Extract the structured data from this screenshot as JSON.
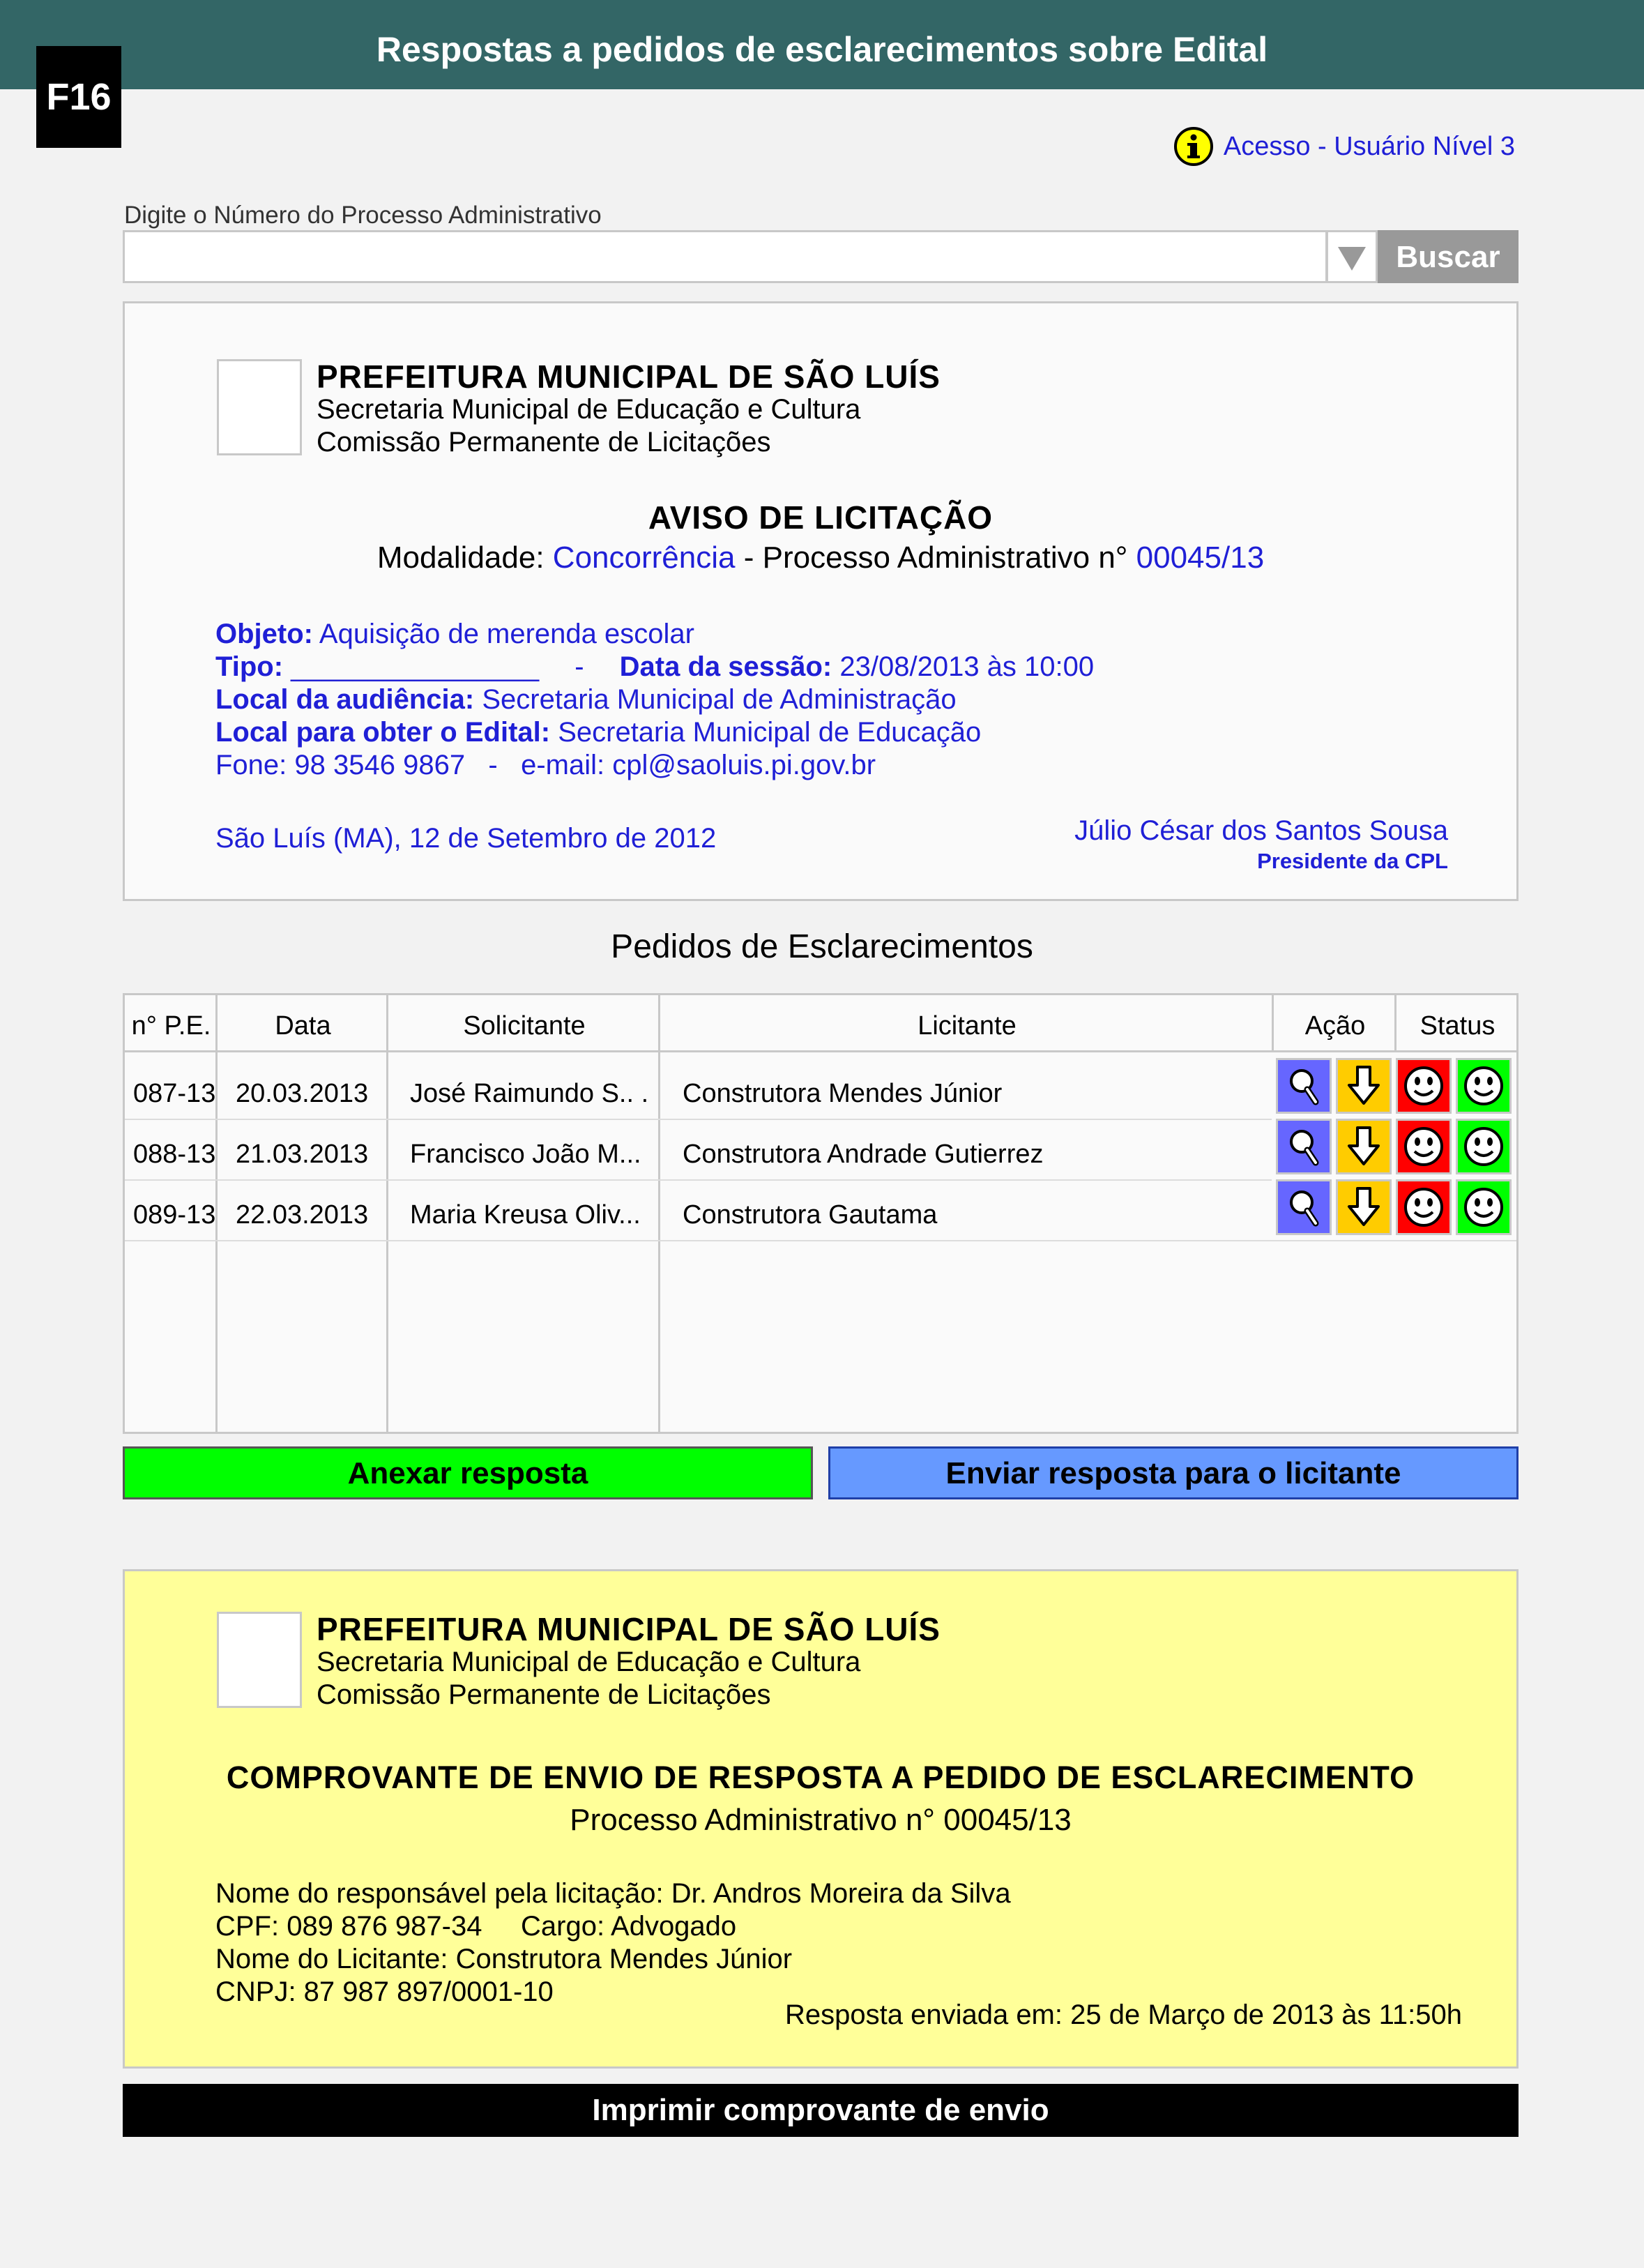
{
  "header": {
    "title": "Respostas a pedidos de esclarecimentos sobre Edital",
    "screen_id": "F16"
  },
  "access": {
    "label": "Acesso - Usuário Nível 3",
    "icon": "info-icon"
  },
  "search": {
    "label": "Digite o Número do Processo Administrativo",
    "value": "",
    "placeholder": "",
    "button": "Buscar"
  },
  "notice": {
    "org": {
      "name": "PREFEITURA MUNICIPAL DE SÃO LUÍS",
      "dept": "Secretaria Municipal de Educação e Cultura",
      "commission": "Comissão Permanente de Licitações"
    },
    "title": "AVISO DE LICITAÇÃO",
    "modality_label": "Modalidade:",
    "modality_value": "Concorrência",
    "process_label": "- Processo Administrativo n°",
    "process_value": "00045/13",
    "object_label": "Objeto:",
    "object_value": "Aquisição de merenda escolar",
    "type_label": "Tipo:",
    "type_value": "________________",
    "dash": "-",
    "session_label": "Data da sessão:",
    "session_value": "23/08/2013 às 10:00",
    "hearing_label": "Local da audiência:",
    "hearing_value": "Secretaria Municipal de Administração",
    "edital_label": "Local para obter o Edital:",
    "edital_value": "Secretaria Municipal de Educação",
    "contact": "Fone: 98 3546 9867   -   e-mail: cpl@saoluis.pi.gov.br",
    "date_place": "São Luís (MA), 12 de Setembro de 2012",
    "signer": "Júlio César dos Santos Sousa",
    "signer_role": "Presidente da CPL"
  },
  "requests": {
    "title": "Pedidos de Esclarecimentos",
    "columns": [
      "n° P.E.",
      "Data",
      "Solicitante",
      "Licitante",
      "Ação",
      "Status"
    ],
    "rows": [
      {
        "num": "087-13",
        "date": "20.03.2013",
        "requester": "José Raimundo S.. .",
        "bidder": "Construtora Mendes Júnior"
      },
      {
        "num": "088-13",
        "date": "21.03.2013",
        "requester": "Francisco João M...",
        "bidder": "Construtora Andrade Gutierrez"
      },
      {
        "num": "089-13",
        "date": "22.03.2013",
        "requester": "Maria Kreusa Oliv...",
        "bidder": "Construtora Gautama"
      }
    ],
    "action_icons": [
      "magnifier-icon",
      "download-arrow-icon"
    ],
    "status_icons": [
      "smiley-red-icon",
      "smiley-green-icon"
    ],
    "colors": {
      "view": "#6666ff",
      "download": "#ffcc00",
      "status_red": "#ff0000",
      "status_green": "#00ff00"
    }
  },
  "buttons": {
    "attach": "Anexar resposta",
    "send": "Enviar resposta para o licitante",
    "attach_color": "#00ff00",
    "send_color": "#6699ff"
  },
  "receipt": {
    "org": {
      "name": "PREFEITURA MUNICIPAL DE SÃO LUÍS",
      "dept": "Secretaria Municipal de Educação e Cultura",
      "commission": "Comissão Permanente de Licitações"
    },
    "title": "COMPROVANTE DE ENVIO DE RESPOSTA A PEDIDO DE ESCLARECIMENTO",
    "process": "Processo Administrativo n° 00045/13",
    "responsible": "Nome do responsável pela licitação: Dr. Andros Moreira da Silva",
    "cpf_cargo": "CPF: 089 876 987-34     Cargo: Advogado",
    "bidder": "Nome do Licitante: Construtora Mendes Júnior",
    "cnpj": "CNPJ: 87 987 897/0001-10",
    "sent_at": "Resposta enviada em: 25 de Março de 2013 às 11:50h"
  },
  "print": {
    "label": "Imprimir comprovante de envio"
  }
}
